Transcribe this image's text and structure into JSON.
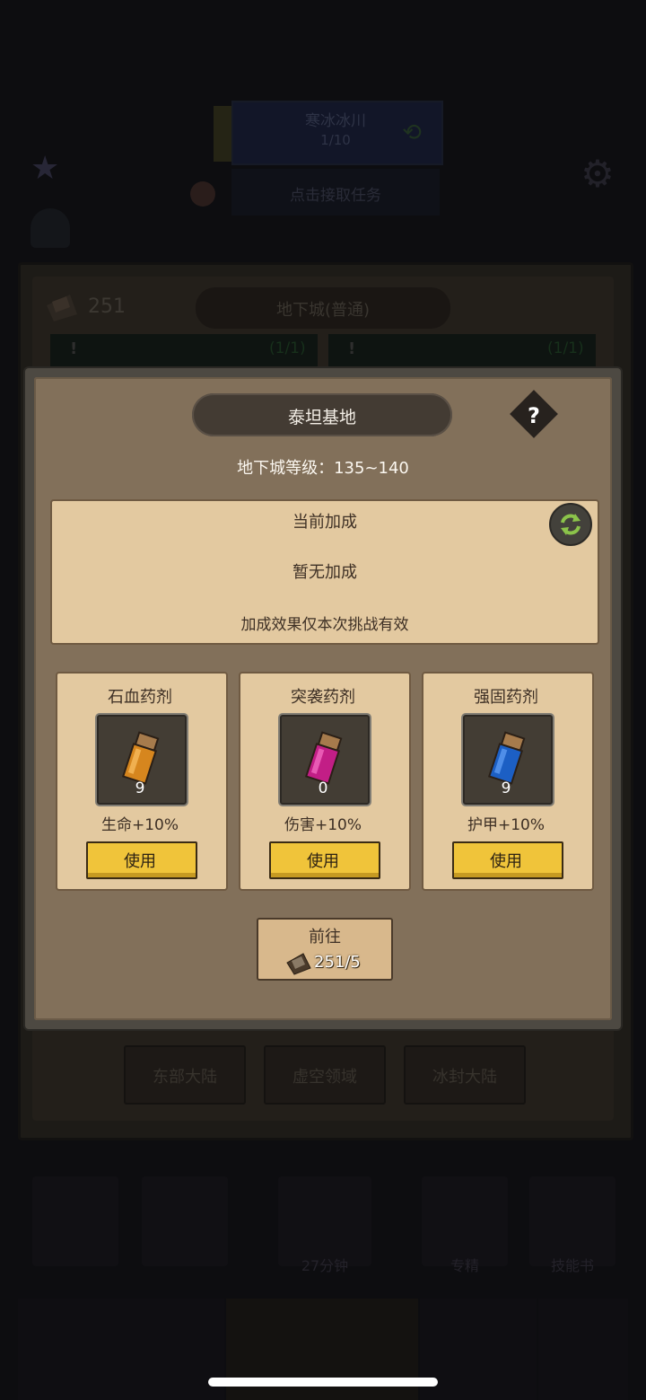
{
  "background": {
    "quest": {
      "title": "寒冰冰川",
      "progress": "1/10",
      "claim_label": "点击接取任务"
    },
    "dungeon_window": {
      "ticket_count": "251",
      "title": "地下城(普通)",
      "cards": [
        {
          "alert": "!",
          "count": "(1/1)"
        },
        {
          "alert": "!",
          "count": "(1/1)"
        }
      ],
      "regions": [
        "东部大陆",
        "虚空领域",
        "冰封大陆"
      ]
    },
    "bottom_bar": {
      "timer": "27分钟",
      "items": [
        "专精",
        "技能书"
      ]
    }
  },
  "popup": {
    "title": "泰坦基地",
    "help_symbol": "?",
    "level_text": "地下城等级：135~140",
    "bonus": {
      "title": "当前加成",
      "value": "暂无加成",
      "note": "加成效果仅本次挑战有效"
    },
    "potions": [
      {
        "name": "石血药剂",
        "count": "9",
        "effect": "生命+10%",
        "use_label": "使用",
        "color": "#d6861e"
      },
      {
        "name": "突袭药剂",
        "count": "0",
        "effect": "伤害+10%",
        "use_label": "使用",
        "color": "#c21e86"
      },
      {
        "name": "强固药剂",
        "count": "9",
        "effect": "护甲+10%",
        "use_label": "使用",
        "color": "#1c5fc4"
      }
    ],
    "go": {
      "label": "前往",
      "cost": "251/5"
    }
  },
  "colors": {
    "popup_bg": "#82705a",
    "parchment": "#e3c9a0",
    "button_gold": "#f0c43a",
    "refresh_green": "#8bc34a"
  }
}
